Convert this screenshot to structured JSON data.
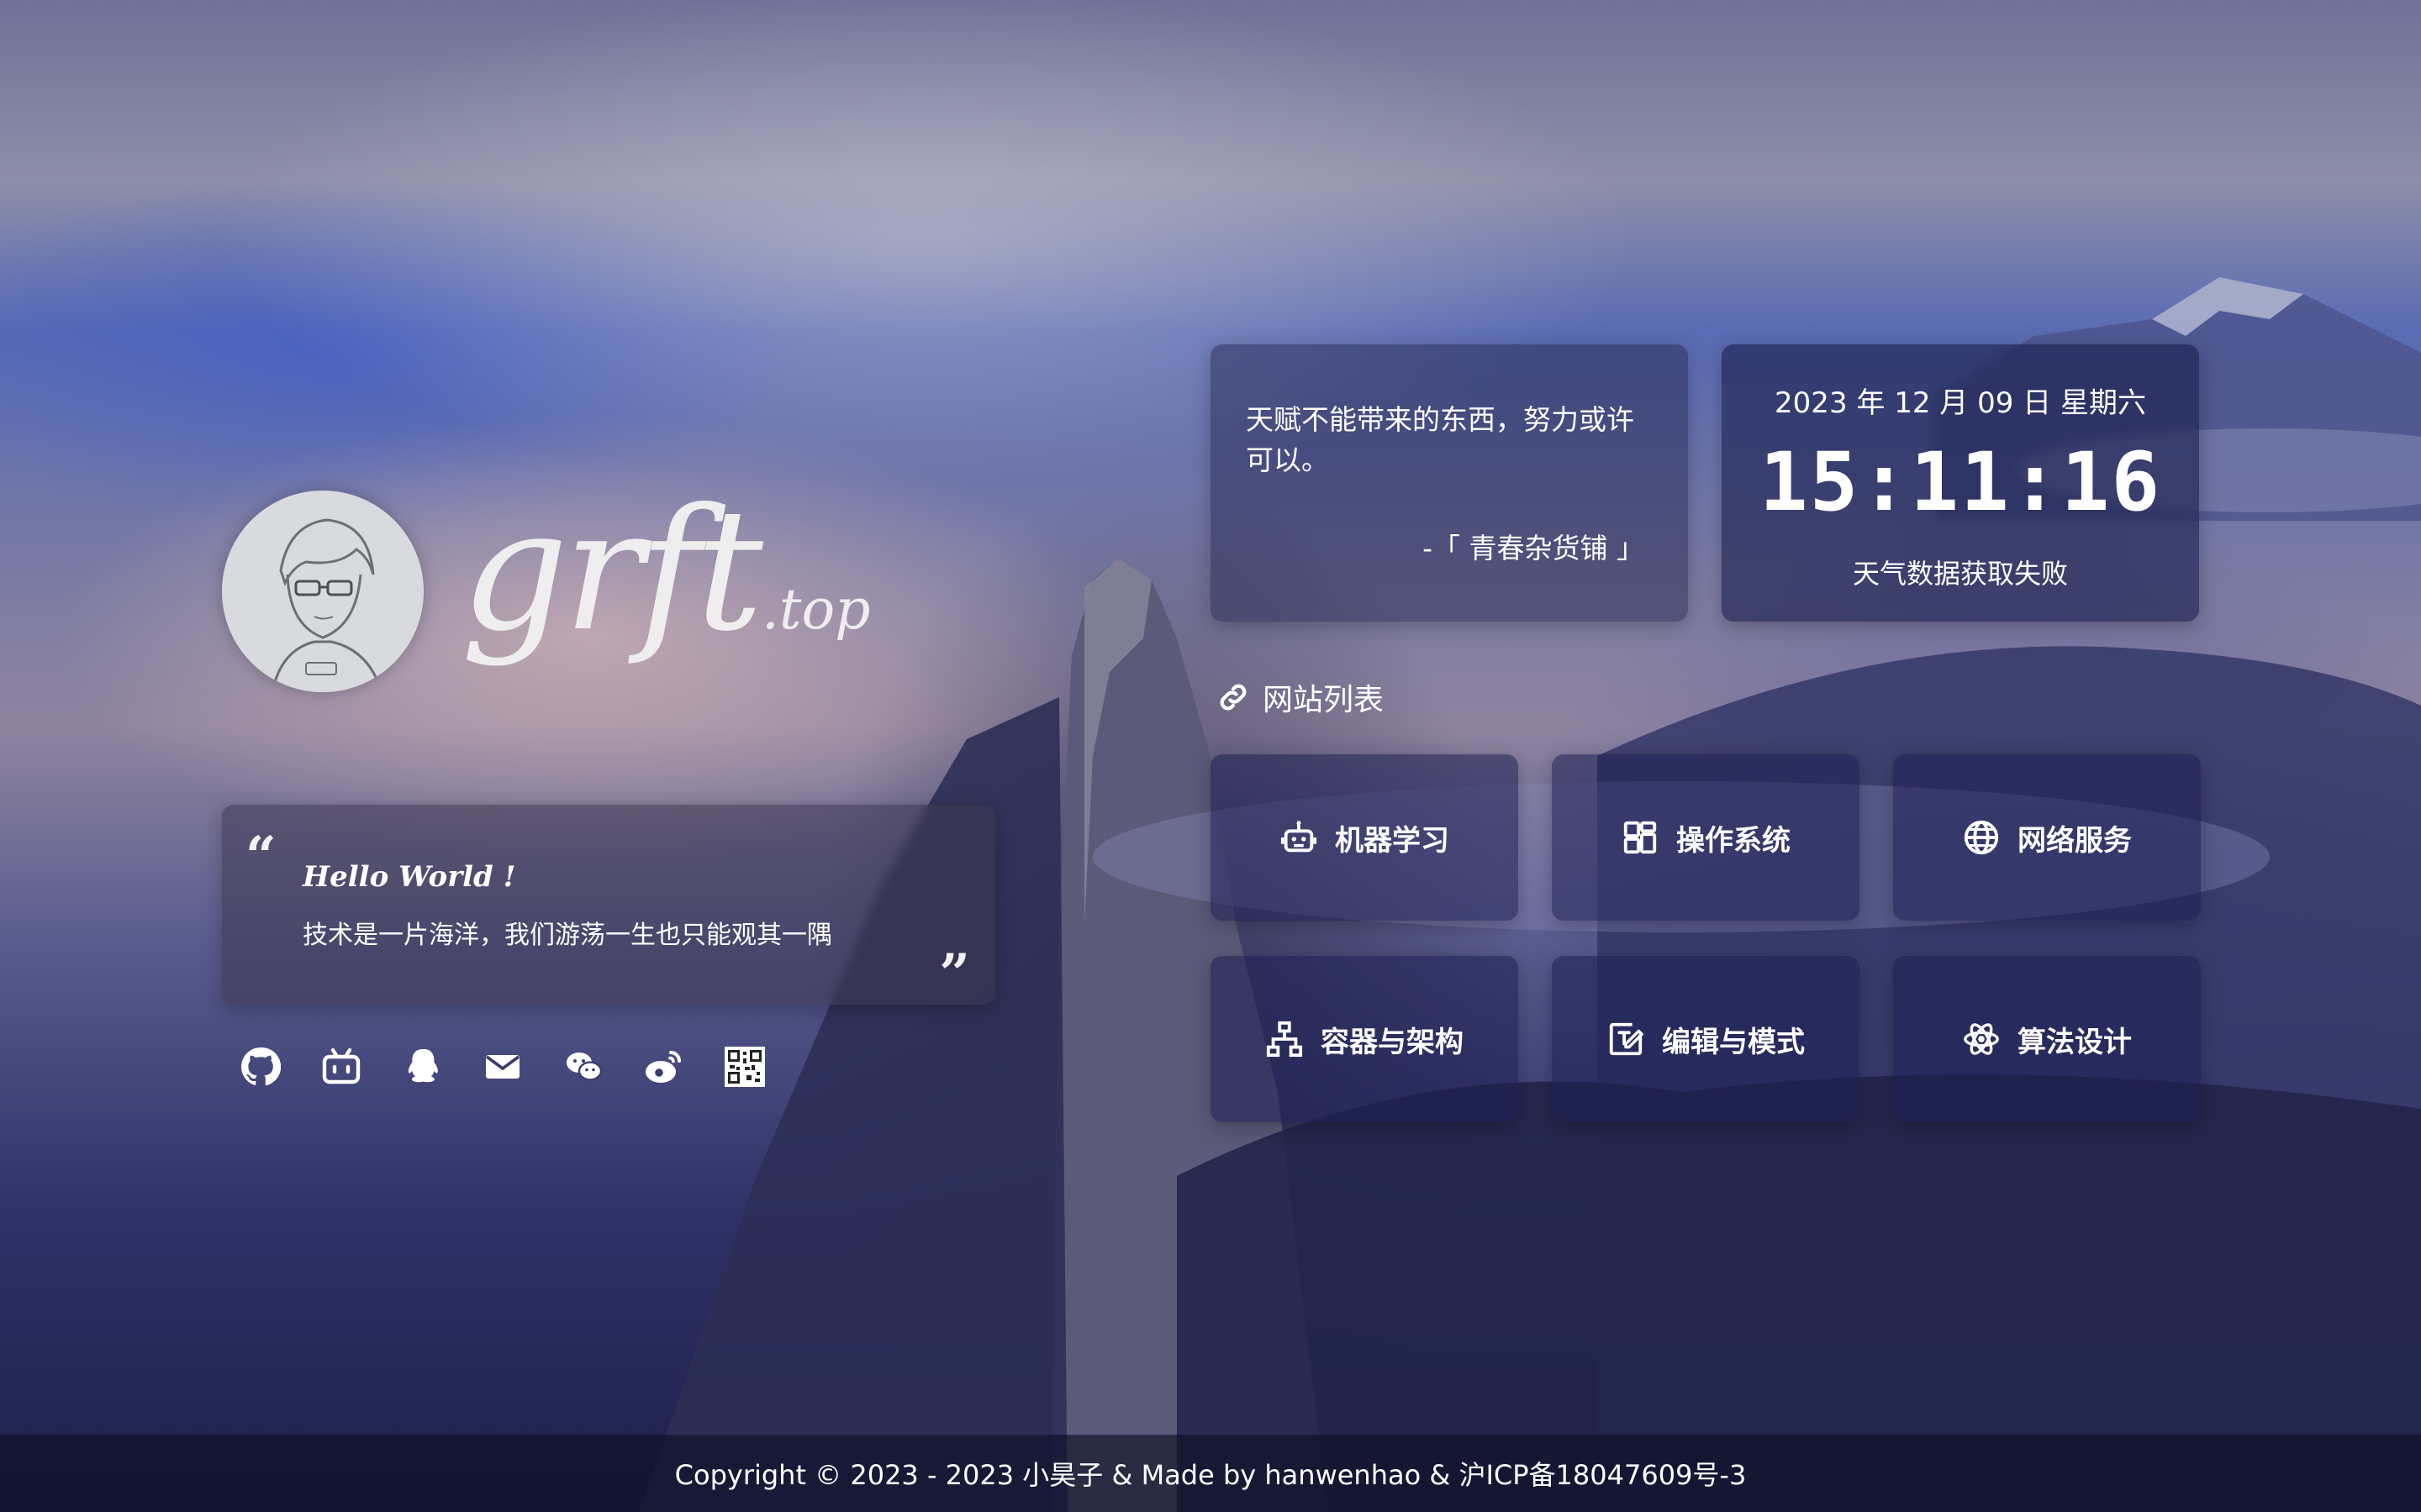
{
  "brand": {
    "logo_main": "grft",
    "logo_tld": ".top"
  },
  "hello": {
    "open_quote": "“",
    "close_quote": "”",
    "title": "Hello World !",
    "text": "技术是一片海洋，我们游荡一生也只能观其一隅"
  },
  "social": [
    {
      "name": "github-icon"
    },
    {
      "name": "bilibili-icon"
    },
    {
      "name": "qq-icon"
    },
    {
      "name": "mail-icon"
    },
    {
      "name": "wechat-icon"
    },
    {
      "name": "weibo-icon"
    },
    {
      "name": "qrcode-icon"
    }
  ],
  "quote": {
    "text": "天赋不能带来的东西，努力或许可以。",
    "source": "-「 青春杂货铺 」"
  },
  "clock": {
    "date": "2023 年 12 月 09 日 星期六",
    "time": "15:11:16",
    "weather": "天气数据获取失败"
  },
  "site_list": {
    "title": "网站列表",
    "icon": "link-icon",
    "items": [
      {
        "label": "机器学习",
        "icon": "robot-icon"
      },
      {
        "label": "操作系统",
        "icon": "windows-icon"
      },
      {
        "label": "网络服务",
        "icon": "globe-icon"
      },
      {
        "label": "容器与架构",
        "icon": "sitemap-icon"
      },
      {
        "label": "编辑与模式",
        "icon": "edit-icon"
      },
      {
        "label": "算法设计",
        "icon": "atom-icon"
      }
    ]
  },
  "footer": {
    "text": "Copyright © 2023 - 2023 小昊子 & Made by hanwenhao & 沪ICP备18047609号-3"
  }
}
